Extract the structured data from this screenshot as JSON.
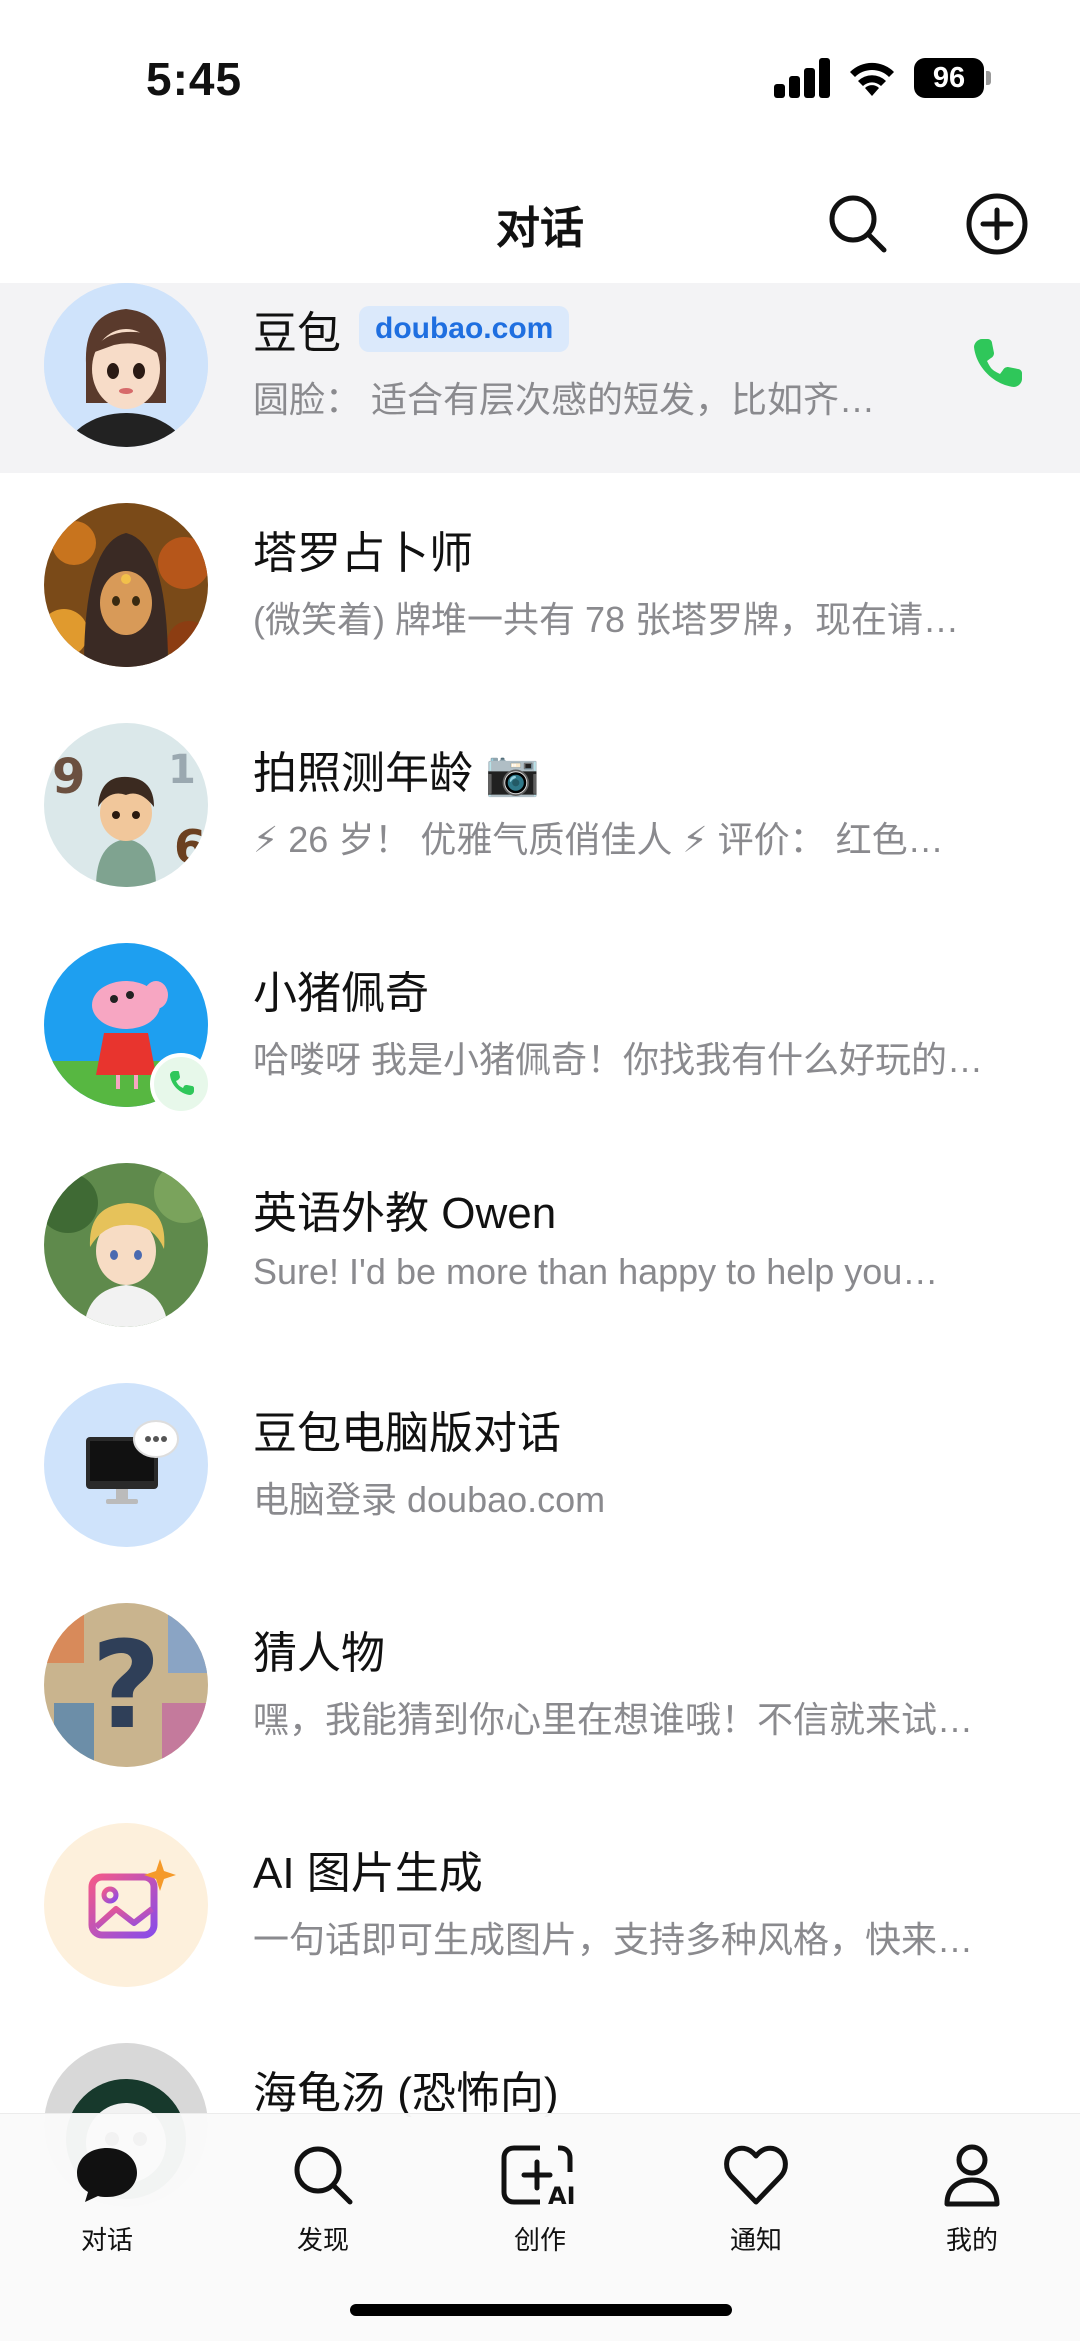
{
  "status_bar": {
    "time": "5:45",
    "battery": "96"
  },
  "header": {
    "title": "对话"
  },
  "chats": [
    {
      "name": "豆包",
      "badge": "doubao.com",
      "preview": "圆脸： 适合有层次感的短发，比如齐…"
    },
    {
      "name": "塔罗占卜师",
      "preview": "(微笑着) 牌堆一共有 78 张塔罗牌，现在请…"
    },
    {
      "name": "拍照测年龄 📷",
      "preview": "⚡ 26 岁！ 优雅气质俏佳人 ⚡ 评价： 红色…"
    },
    {
      "name": "小猪佩奇",
      "preview": "哈喽呀 我是小猪佩奇！你找我有什么好玩的…"
    },
    {
      "name": "英语外教 Owen",
      "preview": "Sure! I'd be more than happy to help you…"
    },
    {
      "name": "豆包电脑版对话",
      "preview": "电脑登录 doubao.com"
    },
    {
      "name": "猜人物",
      "preview": "嘿，我能猜到你心里在想谁哦！不信就来试…"
    },
    {
      "name": "AI 图片生成",
      "preview": "一句话即可生成图片，支持多种风格，快来…"
    },
    {
      "name": "海龟汤 (恐怖向)",
      "preview": ""
    }
  ],
  "tabs": [
    {
      "label": "对话",
      "icon": "chat-bubble-icon"
    },
    {
      "label": "发现",
      "icon": "search-icon"
    },
    {
      "label": "创作",
      "icon": "create-ai-icon"
    },
    {
      "label": "通知",
      "icon": "heart-icon"
    },
    {
      "label": "我的",
      "icon": "profile-icon"
    }
  ],
  "colors": {
    "accent_green": "#2fc75a",
    "badge_blue": "#1f6fe0",
    "pinned_bg": "#f3f3f5",
    "preview_gray": "#8a8a8e"
  }
}
